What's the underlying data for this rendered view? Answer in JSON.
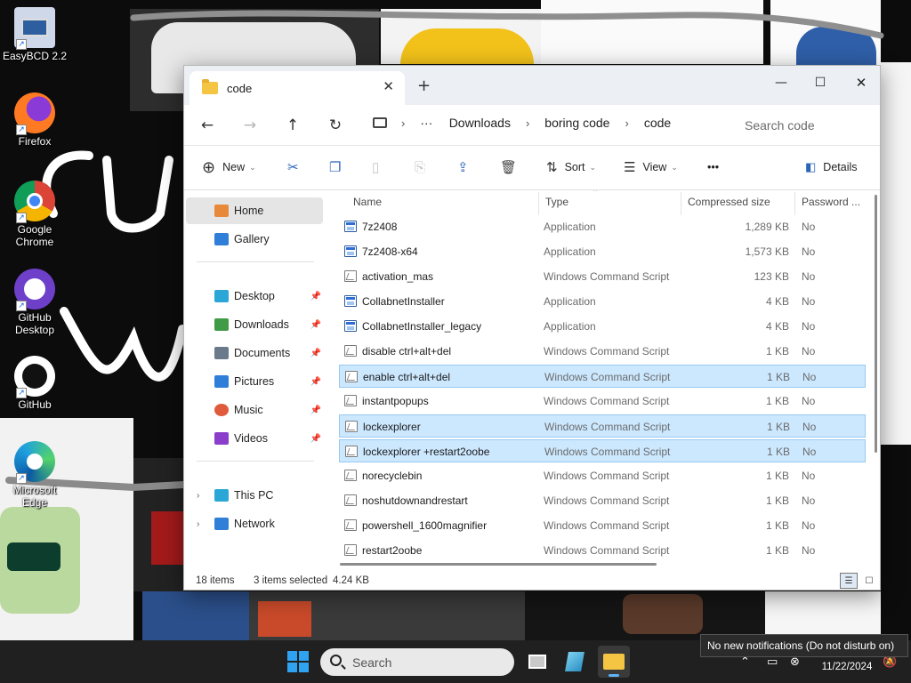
{
  "desktop": {
    "icons": [
      {
        "label": "EasyBCD 2.2"
      },
      {
        "label": "Firefox"
      },
      {
        "label": "Google Chrome"
      },
      {
        "label": "GitHub Desktop"
      },
      {
        "label": "GitHub"
      },
      {
        "label": "Microsoft Edge"
      }
    ]
  },
  "window": {
    "tab_title": "code",
    "tab_close": "✕",
    "new_tab": "+",
    "controls": {
      "minimize": "—",
      "maximize": "☐",
      "close": "✕"
    },
    "nav": {
      "back": "←",
      "forward": "→",
      "up": "↑",
      "refresh": "↻"
    },
    "breadcrumb": {
      "more": "···",
      "items": [
        "Downloads",
        "boring code",
        "code"
      ],
      "separator": "›"
    },
    "search_placeholder": "Search code",
    "toolbar": {
      "new": "New",
      "sort": "Sort",
      "view": "View",
      "more": "•••",
      "details": "Details"
    },
    "navpane": {
      "items": [
        {
          "label": "Home",
          "color": "#e8893a"
        },
        {
          "label": "Gallery",
          "color": "#2f7fd8"
        },
        {
          "label": "Desktop",
          "color": "#2aa7d6"
        },
        {
          "label": "Downloads",
          "color": "#3f9b45"
        },
        {
          "label": "Documents",
          "color": "#6b7a8a"
        },
        {
          "label": "Pictures",
          "color": "#2f7fd8"
        },
        {
          "label": "Music",
          "color": "#e05a3c"
        },
        {
          "label": "Videos",
          "color": "#8a3ec9"
        },
        {
          "label": "This PC",
          "color": "#2aa7d6"
        },
        {
          "label": "Network",
          "color": "#2f7fd8"
        }
      ]
    },
    "columns": {
      "name": "Name",
      "type": "Type",
      "size": "Compressed size",
      "password": "Password ..."
    },
    "files": [
      {
        "name": "7z2408",
        "type": "Application",
        "size": "1,289 KB",
        "password": "No",
        "kind": "app",
        "selected": false
      },
      {
        "name": "7z2408-x64",
        "type": "Application",
        "size": "1,573 KB",
        "password": "No",
        "kind": "app",
        "selected": false
      },
      {
        "name": "activation_mas",
        "type": "Windows Command Script",
        "size": "123 KB",
        "password": "No",
        "kind": "cmd",
        "selected": false
      },
      {
        "name": "CollabnetInstaller",
        "type": "Application",
        "size": "4 KB",
        "password": "No",
        "kind": "app",
        "selected": false
      },
      {
        "name": "CollabnetInstaller_legacy",
        "type": "Application",
        "size": "4 KB",
        "password": "No",
        "kind": "app",
        "selected": false
      },
      {
        "name": "disable ctrl+alt+del",
        "type": "Windows Command Script",
        "size": "1 KB",
        "password": "No",
        "kind": "cmd",
        "selected": false
      },
      {
        "name": "enable ctrl+alt+del",
        "type": "Windows Command Script",
        "size": "1 KB",
        "password": "No",
        "kind": "cmd",
        "selected": true
      },
      {
        "name": "instantpopups",
        "type": "Windows Command Script",
        "size": "1 KB",
        "password": "No",
        "kind": "cmd",
        "selected": false
      },
      {
        "name": "lockexplorer",
        "type": "Windows Command Script",
        "size": "1 KB",
        "password": "No",
        "kind": "cmd",
        "selected": true
      },
      {
        "name": "lockexplorer +restart2oobe",
        "type": "Windows Command Script",
        "size": "1 KB",
        "password": "No",
        "kind": "cmd",
        "selected": true
      },
      {
        "name": "norecyclebin",
        "type": "Windows Command Script",
        "size": "1 KB",
        "password": "No",
        "kind": "cmd",
        "selected": false
      },
      {
        "name": "noshutdownandrestart",
        "type": "Windows Command Script",
        "size": "1 KB",
        "password": "No",
        "kind": "cmd",
        "selected": false
      },
      {
        "name": "powershell_1600magnifier",
        "type": "Windows Command Script",
        "size": "1 KB",
        "password": "No",
        "kind": "cmd",
        "selected": false
      },
      {
        "name": "restart2oobe",
        "type": "Windows Command Script",
        "size": "1 KB",
        "password": "No",
        "kind": "cmd",
        "selected": false
      }
    ],
    "status": {
      "count": "18 items",
      "selected": "3 items selected",
      "size": "4.24 KB"
    }
  },
  "taskbar": {
    "search_placeholder": "Search",
    "date": "11/22/2024",
    "notification": "No new notifications (Do not disturb on)"
  }
}
